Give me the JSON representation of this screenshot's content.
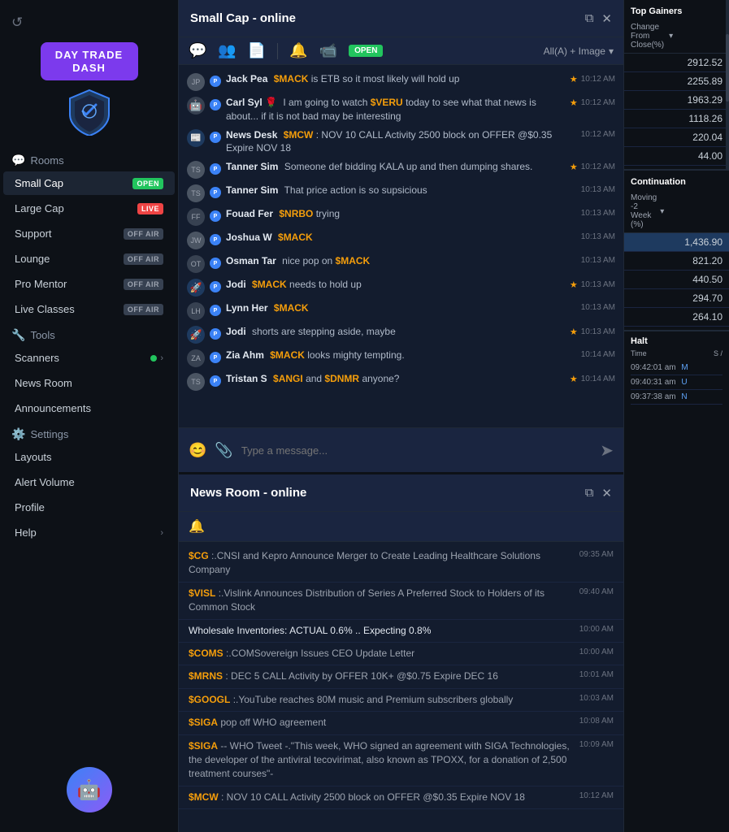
{
  "app": {
    "title": "Day Trade Dash",
    "refresh_icon": "↺"
  },
  "sidebar": {
    "sections": [
      {
        "title": "Rooms",
        "icon": "💬",
        "items": [
          {
            "label": "Small Cap",
            "badge": "OPEN",
            "badge_type": "open",
            "active": true
          },
          {
            "label": "Large Cap",
            "badge": "LIVE",
            "badge_type": "live"
          },
          {
            "label": "Support",
            "badge": "OFF AIR",
            "badge_type": "offair"
          },
          {
            "label": "Lounge",
            "badge": "OFF AIR",
            "badge_type": "offair"
          },
          {
            "label": "Pro Mentor",
            "badge": "OFF AIR",
            "badge_type": "offair"
          },
          {
            "label": "Live Classes",
            "badge": "OFF AIR",
            "badge_type": "offair"
          }
        ]
      },
      {
        "title": "Tools",
        "icon": "🔧",
        "items": [
          {
            "label": "Scanners",
            "has_dot": true,
            "has_arrow": true
          },
          {
            "label": "News Room",
            "has_dot": false,
            "has_arrow": false
          },
          {
            "label": "Announcements",
            "has_dot": false,
            "has_arrow": false
          }
        ]
      },
      {
        "title": "Settings",
        "icon": "⚙️",
        "items": [
          {
            "label": "Layouts"
          },
          {
            "label": "Alert Volume"
          },
          {
            "label": "Profile"
          },
          {
            "label": "Help",
            "has_arrow": true
          }
        ]
      }
    ]
  },
  "chat_panel": {
    "title": "Small Cap - online",
    "status": "online",
    "toolbar_badge": "OPEN",
    "filter_label": "All(A) + Image",
    "messages": [
      {
        "avatar_initials": "?",
        "has_p": true,
        "name": "Jack Pea",
        "text": "$MACK is ETB so it most likely will hold up",
        "time": "10:12 AM",
        "has_star": true,
        "ticker": "$MACK"
      },
      {
        "avatar_initials": "🤖",
        "has_p": true,
        "name": "Carl Syl",
        "emoji": "🌹",
        "text": "I am going to watch $VERU today to see what that news is about... if it is not bad may be interesting",
        "time": "10:12 AM",
        "has_star": true,
        "ticker": "$VERU"
      },
      {
        "avatar_initials": "📰",
        "has_p": true,
        "name": "News Desk",
        "text": "$MCW: NOV 10 CALL Activity 2500 block on OFFER @$0.35 Expire NOV 18",
        "time": "10:12 AM",
        "has_star": false
      },
      {
        "avatar_initials": "T",
        "has_p": true,
        "name": "Tanner Sim",
        "text": "Someone def bidding KALA up and then dumping shares.",
        "time": "10:12 AM",
        "has_star": true
      },
      {
        "avatar_initials": "T",
        "has_p": true,
        "name": "Tanner Sim",
        "text": "That price action is so supsicious",
        "time": "10:13 AM",
        "has_star": false
      },
      {
        "avatar_initials": "F",
        "has_p": true,
        "name": "Fouad Fer",
        "text": "$NRBO trying",
        "time": "10:13 AM",
        "has_star": false,
        "ticker": "$NRBO"
      },
      {
        "avatar_initials": "J",
        "has_p": true,
        "name": "Joshua W",
        "text": "$MACK",
        "time": "10:13 AM",
        "has_star": false,
        "ticker": "$MACK"
      },
      {
        "avatar_initials": "O",
        "has_p": true,
        "name": "Osman Tar",
        "text": "nice pop on $MACK",
        "time": "10:13 AM",
        "has_star": false,
        "ticker": "$MACK"
      },
      {
        "avatar_initials": "J",
        "has_p": true,
        "name": "Jodi",
        "text": "$MACK needs to hold up",
        "time": "10:13 AM",
        "has_star": true,
        "ticker": "$MACK"
      },
      {
        "avatar_initials": "L",
        "has_p": true,
        "name": "Lynn Her",
        "text": "$MACK",
        "time": "10:13 AM",
        "has_star": false,
        "ticker": "$MACK"
      },
      {
        "avatar_initials": "J",
        "has_p": true,
        "name": "Jodi",
        "text": "shorts are stepping aside, maybe",
        "time": "10:13 AM",
        "has_star": true
      },
      {
        "avatar_initials": "Z",
        "has_p": true,
        "name": "Zia Ahm",
        "text": "$MACK looks mighty tempting.",
        "time": "10:14 AM",
        "has_star": false,
        "ticker": "$MACK"
      },
      {
        "avatar_initials": "T",
        "has_p": true,
        "name": "Tristan S",
        "text": "$ANGI and $DNMR anyone?",
        "time": "10:14 AM",
        "has_star": true,
        "tickers": [
          "$ANGI",
          "$DNMR"
        ]
      }
    ],
    "input_placeholder": "Type a message..."
  },
  "news_panel": {
    "title": "News Room - online",
    "items": [
      {
        "text": "$CG:.CNSI and Kepro Announce Merger to Create Leading Healthcare Solutions Company",
        "time": "09:35 AM",
        "ticker": "$CG"
      },
      {
        "text": "$VISL:.Vislink Announces Distribution of Series A Preferred Stock to Holders of its Common Stock",
        "time": "09:40 AM",
        "ticker": "$VISL"
      },
      {
        "text": "Wholesale Inventories: ACTUAL 0.6% .. Expecting 0.8%",
        "time": "10:00 AM",
        "ticker": null
      },
      {
        "text": "$COMS:.COMSovereign Issues CEO Update Letter",
        "time": "10:00 AM",
        "ticker": "$COMS"
      },
      {
        "text": "$MRNS: DEC 5 CALL Activity by OFFER 10K+ @$0.75 Expire DEC 16",
        "time": "10:01 AM",
        "ticker": "$MRNS"
      },
      {
        "text": "$GOOGL:.YouTube reaches 80M music and Premium subscribers globally",
        "time": "10:03 AM",
        "ticker": "$GOOGL"
      },
      {
        "text": "$SIGA pop off WHO agreement",
        "time": "10:08 AM",
        "ticker": "$SIGA"
      },
      {
        "text": "$SIGA -- WHO Tweet -:\"This week, WHO signed an agreement with SIGA Technologies, the developer of the antiviral tecovirimat, also known as TPOXX, for a donation of 2,500 treatment courses\"-",
        "time": "10:09 AM",
        "ticker": "$SIGA"
      },
      {
        "text": "$MCW: NOV 10 CALL Activity 2500 block on OFFER @$0.35 Expire NOV 18",
        "time": "10:12 AM",
        "ticker": "$MCW"
      }
    ]
  },
  "right_panel": {
    "top_gainers": {
      "title": "Top Gainers",
      "filter_label": "Change From Close(%)",
      "values": [
        "2912.52",
        "2255.89",
        "1963.29",
        "1118.26",
        "220.04",
        "44.00"
      ]
    },
    "continuation": {
      "title": "Continuation",
      "filter_label": "Moving -2 Week (%)",
      "values": [
        "1,436.90",
        "821.20",
        "440.50",
        "294.70",
        "264.10"
      ]
    },
    "halt": {
      "title": "Halt",
      "col1": "Time",
      "col2": "S /",
      "items": [
        {
          "time": "09:42:01 am",
          "code": "M"
        },
        {
          "time": "09:40:31 am",
          "code": "U"
        },
        {
          "time": "09:37:38 am",
          "code": "N"
        }
      ]
    }
  },
  "colors": {
    "brand_purple": "#7c3aed",
    "green": "#22c55e",
    "red": "#ef4444",
    "yellow": "#f59e0b",
    "blue": "#3b82f6",
    "bg_dark": "#0d1117",
    "bg_panel": "#131c2e",
    "bg_header": "#1a2540"
  }
}
